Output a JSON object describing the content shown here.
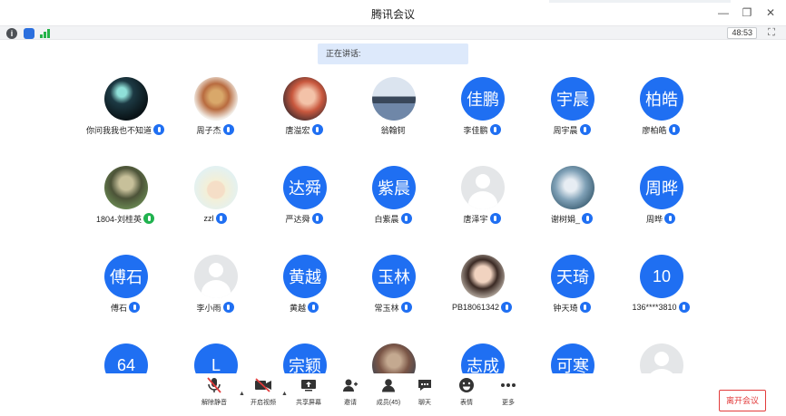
{
  "window": {
    "title": "腾讯会议"
  },
  "status": {
    "timer": "48:53"
  },
  "speaking": {
    "label": "正在讲话:"
  },
  "participants": [
    {
      "name": "你问我我也不知道",
      "avatar_type": "photo1",
      "avatar_text": "",
      "mic": "blue-mic-icon"
    },
    {
      "name": "周子杰",
      "avatar_type": "photo2",
      "avatar_text": "",
      "mic": "blue-mic-icon"
    },
    {
      "name": "唐溢宏",
      "avatar_type": "photo3",
      "avatar_text": "",
      "mic": "blue-mic-icon"
    },
    {
      "name": "翁翰钶",
      "avatar_type": "photo4",
      "avatar_text": "",
      "mic": ""
    },
    {
      "name": "李佳鹏",
      "avatar_type": "text",
      "avatar_text": "佳鹏",
      "mic": "blue-mic-icon"
    },
    {
      "name": "周宇晨",
      "avatar_type": "text",
      "avatar_text": "宇晨",
      "mic": "blue-mic-icon"
    },
    {
      "name": "廖柏皓",
      "avatar_type": "text",
      "avatar_text": "柏皓",
      "mic": "blue-mic-icon"
    },
    {
      "name": "1804-刘桂英",
      "avatar_type": "photo5",
      "avatar_text": "",
      "mic": "green-mic-icon"
    },
    {
      "name": "zzl",
      "avatar_type": "photo6",
      "avatar_text": "",
      "mic": "blue-mic-icon"
    },
    {
      "name": "严达舜",
      "avatar_type": "text",
      "avatar_text": "达舜",
      "mic": "blue-mic-icon"
    },
    {
      "name": "白紫晨",
      "avatar_type": "text",
      "avatar_text": "紫晨",
      "mic": "blue-mic-icon"
    },
    {
      "name": "唐泽宇",
      "avatar_type": "gray",
      "avatar_text": "",
      "mic": "blue-mic-icon"
    },
    {
      "name": "谢树娟_",
      "avatar_type": "photo7",
      "avatar_text": "",
      "mic": "blue-mic-icon"
    },
    {
      "name": "周晔",
      "avatar_type": "text",
      "avatar_text": "周晔",
      "mic": "blue-mic-icon"
    },
    {
      "name": "傅石",
      "avatar_type": "text",
      "avatar_text": "傅石",
      "mic": "blue-mic-icon"
    },
    {
      "name": "李小雨",
      "avatar_type": "gray",
      "avatar_text": "",
      "mic": "blue-mic-icon"
    },
    {
      "name": "黄越",
      "avatar_type": "text",
      "avatar_text": "黄越",
      "mic": "blue-mic-icon"
    },
    {
      "name": "常玉林",
      "avatar_type": "text",
      "avatar_text": "玉林",
      "mic": "blue-mic-icon"
    },
    {
      "name": "PB18061342",
      "avatar_type": "photo8",
      "avatar_text": "",
      "mic": "blue-mic-icon"
    },
    {
      "name": "钟天琦",
      "avatar_type": "text",
      "avatar_text": "天琦",
      "mic": "blue-mic-icon"
    },
    {
      "name": "136****3810",
      "avatar_type": "text",
      "avatar_text": "10",
      "mic": "blue-mic-icon"
    },
    {
      "name": "",
      "avatar_type": "text",
      "avatar_text": "64",
      "mic": ""
    },
    {
      "name": "",
      "avatar_type": "text",
      "avatar_text": "L",
      "mic": ""
    },
    {
      "name": "",
      "avatar_type": "text",
      "avatar_text": "宗颖",
      "mic": ""
    },
    {
      "name": "",
      "avatar_type": "photo9",
      "avatar_text": "",
      "mic": ""
    },
    {
      "name": "",
      "avatar_type": "text",
      "avatar_text": "志成",
      "mic": ""
    },
    {
      "name": "",
      "avatar_type": "text",
      "avatar_text": "可寒",
      "mic": ""
    },
    {
      "name": "",
      "avatar_type": "gray",
      "avatar_text": "",
      "mic": ""
    }
  ],
  "toolbar": {
    "unmute": "解除静音",
    "video": "开启视频",
    "share": "共享屏幕",
    "invite": "邀请",
    "members": "成员(45)",
    "chat": "聊天",
    "emoji": "表情",
    "more": "更多",
    "leave": "离开会议"
  },
  "colors": {
    "accent": "#1f6ff2",
    "danger": "#e23b3b",
    "signal": "#25b249"
  }
}
